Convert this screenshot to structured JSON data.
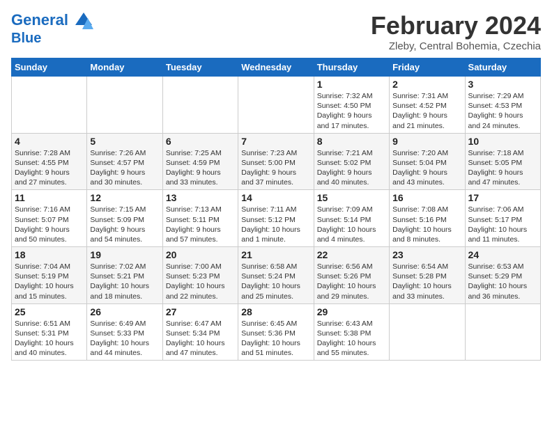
{
  "logo": {
    "line1": "General",
    "line2": "Blue"
  },
  "title": "February 2024",
  "location": "Zleby, Central Bohemia, Czechia",
  "weekdays": [
    "Sunday",
    "Monday",
    "Tuesday",
    "Wednesday",
    "Thursday",
    "Friday",
    "Saturday"
  ],
  "weeks": [
    [
      {
        "day": "",
        "info": ""
      },
      {
        "day": "",
        "info": ""
      },
      {
        "day": "",
        "info": ""
      },
      {
        "day": "",
        "info": ""
      },
      {
        "day": "1",
        "info": "Sunrise: 7:32 AM\nSunset: 4:50 PM\nDaylight: 9 hours\nand 17 minutes."
      },
      {
        "day": "2",
        "info": "Sunrise: 7:31 AM\nSunset: 4:52 PM\nDaylight: 9 hours\nand 21 minutes."
      },
      {
        "day": "3",
        "info": "Sunrise: 7:29 AM\nSunset: 4:53 PM\nDaylight: 9 hours\nand 24 minutes."
      }
    ],
    [
      {
        "day": "4",
        "info": "Sunrise: 7:28 AM\nSunset: 4:55 PM\nDaylight: 9 hours\nand 27 minutes."
      },
      {
        "day": "5",
        "info": "Sunrise: 7:26 AM\nSunset: 4:57 PM\nDaylight: 9 hours\nand 30 minutes."
      },
      {
        "day": "6",
        "info": "Sunrise: 7:25 AM\nSunset: 4:59 PM\nDaylight: 9 hours\nand 33 minutes."
      },
      {
        "day": "7",
        "info": "Sunrise: 7:23 AM\nSunset: 5:00 PM\nDaylight: 9 hours\nand 37 minutes."
      },
      {
        "day": "8",
        "info": "Sunrise: 7:21 AM\nSunset: 5:02 PM\nDaylight: 9 hours\nand 40 minutes."
      },
      {
        "day": "9",
        "info": "Sunrise: 7:20 AM\nSunset: 5:04 PM\nDaylight: 9 hours\nand 43 minutes."
      },
      {
        "day": "10",
        "info": "Sunrise: 7:18 AM\nSunset: 5:05 PM\nDaylight: 9 hours\nand 47 minutes."
      }
    ],
    [
      {
        "day": "11",
        "info": "Sunrise: 7:16 AM\nSunset: 5:07 PM\nDaylight: 9 hours\nand 50 minutes."
      },
      {
        "day": "12",
        "info": "Sunrise: 7:15 AM\nSunset: 5:09 PM\nDaylight: 9 hours\nand 54 minutes."
      },
      {
        "day": "13",
        "info": "Sunrise: 7:13 AM\nSunset: 5:11 PM\nDaylight: 9 hours\nand 57 minutes."
      },
      {
        "day": "14",
        "info": "Sunrise: 7:11 AM\nSunset: 5:12 PM\nDaylight: 10 hours\nand 1 minute."
      },
      {
        "day": "15",
        "info": "Sunrise: 7:09 AM\nSunset: 5:14 PM\nDaylight: 10 hours\nand 4 minutes."
      },
      {
        "day": "16",
        "info": "Sunrise: 7:08 AM\nSunset: 5:16 PM\nDaylight: 10 hours\nand 8 minutes."
      },
      {
        "day": "17",
        "info": "Sunrise: 7:06 AM\nSunset: 5:17 PM\nDaylight: 10 hours\nand 11 minutes."
      }
    ],
    [
      {
        "day": "18",
        "info": "Sunrise: 7:04 AM\nSunset: 5:19 PM\nDaylight: 10 hours\nand 15 minutes."
      },
      {
        "day": "19",
        "info": "Sunrise: 7:02 AM\nSunset: 5:21 PM\nDaylight: 10 hours\nand 18 minutes."
      },
      {
        "day": "20",
        "info": "Sunrise: 7:00 AM\nSunset: 5:23 PM\nDaylight: 10 hours\nand 22 minutes."
      },
      {
        "day": "21",
        "info": "Sunrise: 6:58 AM\nSunset: 5:24 PM\nDaylight: 10 hours\nand 25 minutes."
      },
      {
        "day": "22",
        "info": "Sunrise: 6:56 AM\nSunset: 5:26 PM\nDaylight: 10 hours\nand 29 minutes."
      },
      {
        "day": "23",
        "info": "Sunrise: 6:54 AM\nSunset: 5:28 PM\nDaylight: 10 hours\nand 33 minutes."
      },
      {
        "day": "24",
        "info": "Sunrise: 6:53 AM\nSunset: 5:29 PM\nDaylight: 10 hours\nand 36 minutes."
      }
    ],
    [
      {
        "day": "25",
        "info": "Sunrise: 6:51 AM\nSunset: 5:31 PM\nDaylight: 10 hours\nand 40 minutes."
      },
      {
        "day": "26",
        "info": "Sunrise: 6:49 AM\nSunset: 5:33 PM\nDaylight: 10 hours\nand 44 minutes."
      },
      {
        "day": "27",
        "info": "Sunrise: 6:47 AM\nSunset: 5:34 PM\nDaylight: 10 hours\nand 47 minutes."
      },
      {
        "day": "28",
        "info": "Sunrise: 6:45 AM\nSunset: 5:36 PM\nDaylight: 10 hours\nand 51 minutes."
      },
      {
        "day": "29",
        "info": "Sunrise: 6:43 AM\nSunset: 5:38 PM\nDaylight: 10 hours\nand 55 minutes."
      },
      {
        "day": "",
        "info": ""
      },
      {
        "day": "",
        "info": ""
      }
    ]
  ]
}
